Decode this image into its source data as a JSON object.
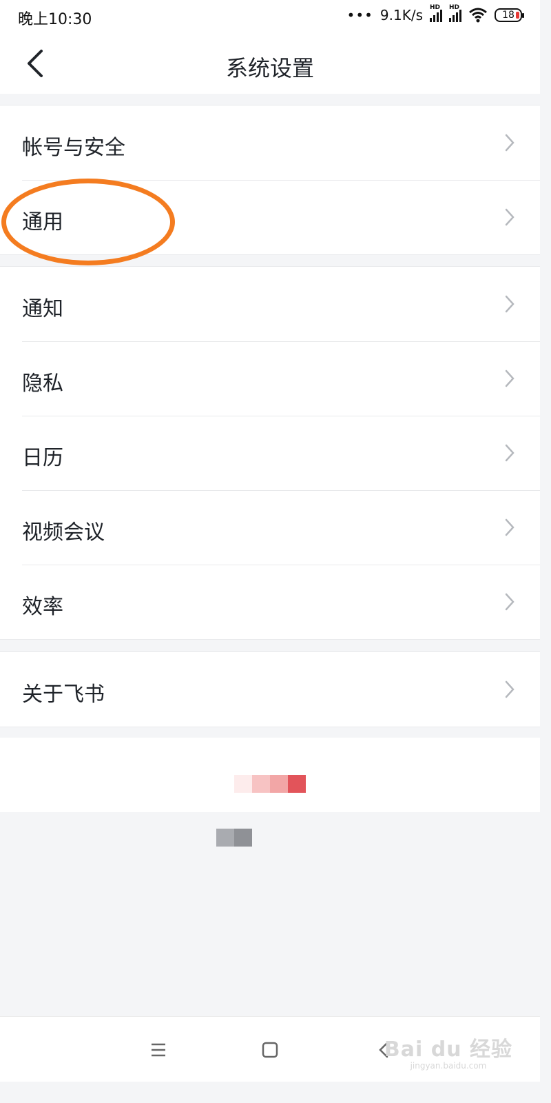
{
  "status_bar": {
    "time": "晚上10:30",
    "dots": "•••",
    "network_speed": "9.1K/s",
    "signal_label_1": "HD",
    "signal_label_2": "HD",
    "battery": "18"
  },
  "header": {
    "title": "系统设置",
    "back_icon": "chevron-left-icon"
  },
  "groups": [
    {
      "items": [
        {
          "label": "帐号与安全"
        },
        {
          "label": "通用"
        }
      ]
    },
    {
      "items": [
        {
          "label": "通知"
        },
        {
          "label": "隐私"
        },
        {
          "label": "日历"
        },
        {
          "label": "视频会议"
        },
        {
          "label": "效率"
        }
      ]
    },
    {
      "items": [
        {
          "label": "关于飞书"
        }
      ]
    }
  ],
  "highlight": {
    "target": "通用",
    "color": "#f47c20"
  },
  "nav_bar": {
    "icons": [
      "menu-icon",
      "home-square-icon",
      "back-triangle-icon"
    ]
  },
  "watermark": {
    "main": "Bai du 经验",
    "sub": "jingyan.baidu.com"
  },
  "colors": {
    "accent": "#f47c20",
    "background": "#f4f5f7",
    "text": "#1f2329",
    "chevron": "#b5b8bd"
  }
}
